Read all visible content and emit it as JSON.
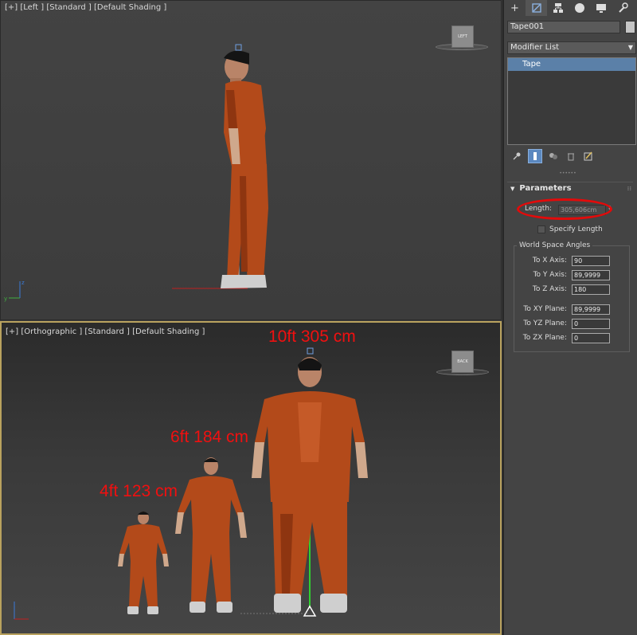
{
  "top_viewport": {
    "label": "[+] [Left ] [Standard ] [Default Shading ]",
    "viewcube_label": "LEFT",
    "axis_y": "y",
    "axis_z": "z"
  },
  "bottom_viewport": {
    "label": "[+] [Orthographic ] [Standard ] [Default Shading ]",
    "viewcube_label": "BACK",
    "annotations": [
      "10ft 305 cm",
      "6ft 184 cm",
      "4ft 123 cm"
    ]
  },
  "command_panel": {
    "tabs": [
      "+",
      "modify",
      "hierarchy",
      "motion",
      "display",
      "utilities"
    ],
    "object_name": "Tape001",
    "object_color": "#c5c5c5",
    "modifier_list": "Modifier List",
    "stack_items": [
      "Tape"
    ],
    "parameters_title": "Parameters",
    "length_label": "Length:",
    "length_value": "305,606cm",
    "specify_length": "Specify Length",
    "world_space_title": "World Space Angles",
    "angles": [
      {
        "label": "To X Axis:",
        "value": "90"
      },
      {
        "label": "To Y Axis:",
        "value": "89,9999"
      },
      {
        "label": "To Z Axis:",
        "value": "180"
      },
      {
        "label": "To XY Plane:",
        "value": "89,9999"
      },
      {
        "label": "To YZ Plane:",
        "value": "0"
      },
      {
        "label": "To ZX Plane:",
        "value": "0"
      }
    ]
  },
  "colors": {
    "annotation_red": "#f01010",
    "active_viewport_border": "#b9a25e",
    "selection_blue": "#5b80a8",
    "jumpsuit_orange": "#b34a1a"
  }
}
